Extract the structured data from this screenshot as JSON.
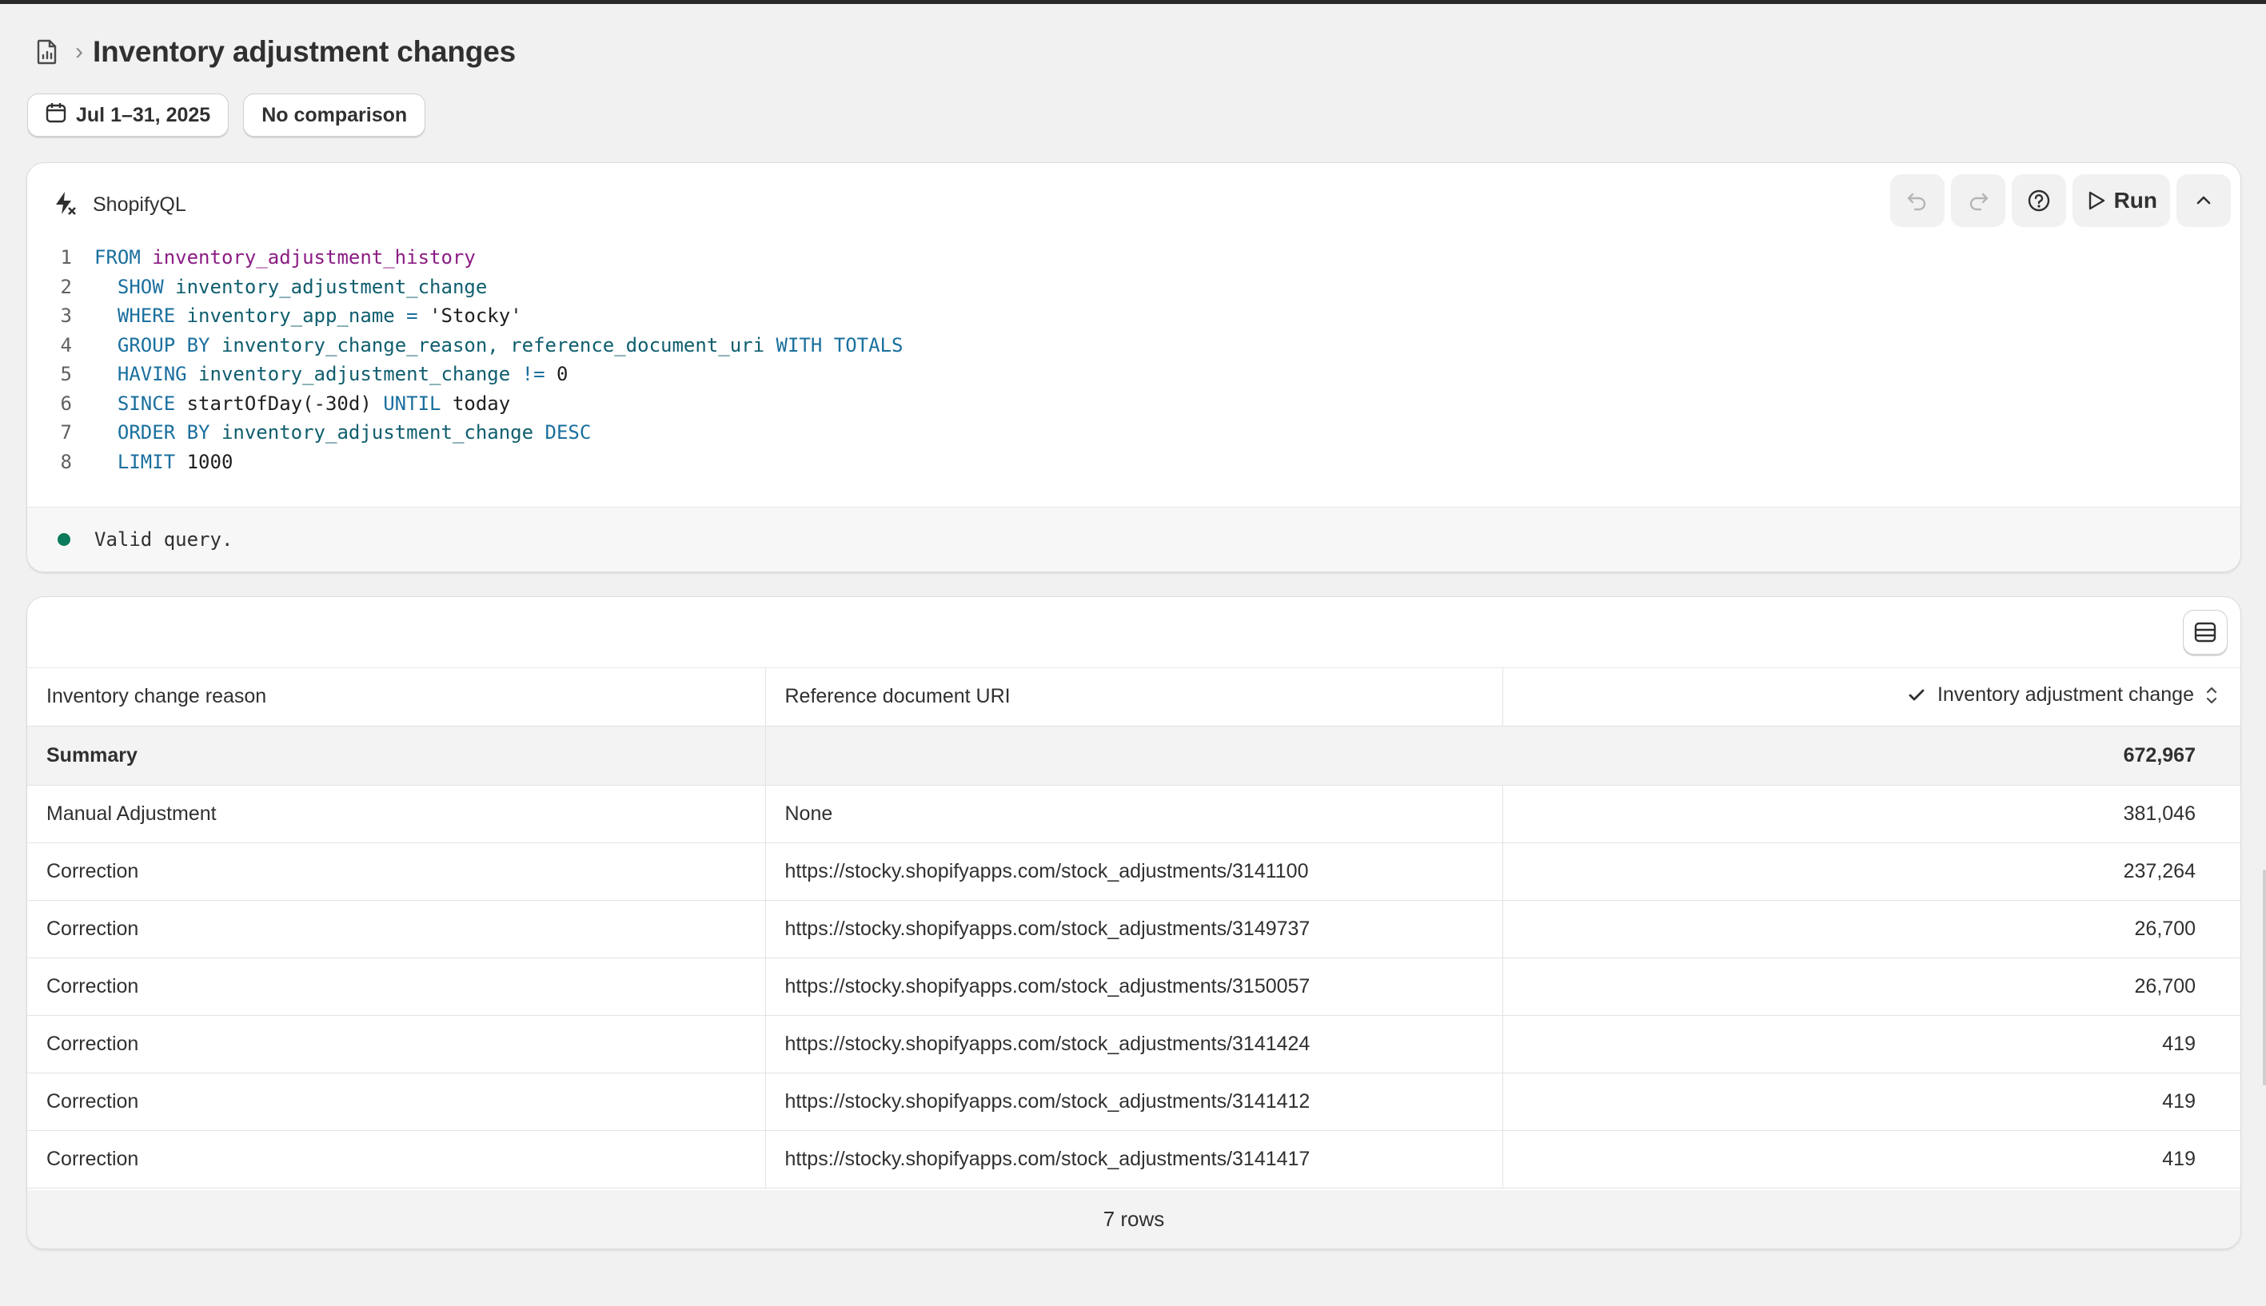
{
  "header": {
    "title": "Inventory adjustment changes",
    "chevron": "›"
  },
  "filters": {
    "date_range": "Jul 1–31, 2025",
    "comparison": "No comparison"
  },
  "editor": {
    "label": "ShopifyQL",
    "run_label": "Run",
    "lines": [
      {
        "n": "1",
        "tokens": [
          {
            "t": "FROM ",
            "c": "kw"
          },
          {
            "t": "inventory_adjustment_history",
            "c": "tbl"
          }
        ]
      },
      {
        "n": "2",
        "tokens": [
          {
            "t": "  SHOW ",
            "c": "kw"
          },
          {
            "t": "inventory_adjustment_change",
            "c": "fld"
          }
        ]
      },
      {
        "n": "3",
        "tokens": [
          {
            "t": "  WHERE ",
            "c": "kw"
          },
          {
            "t": "inventory_app_name ",
            "c": "fld"
          },
          {
            "t": "= ",
            "c": "kw"
          },
          {
            "t": "'Stocky'",
            "c": "plain"
          }
        ]
      },
      {
        "n": "4",
        "tokens": [
          {
            "t": "  GROUP BY ",
            "c": "kw"
          },
          {
            "t": "inventory_change_reason, reference_document_uri ",
            "c": "fld"
          },
          {
            "t": "WITH TOTALS",
            "c": "kw"
          }
        ]
      },
      {
        "n": "5",
        "tokens": [
          {
            "t": "  HAVING ",
            "c": "kw"
          },
          {
            "t": "inventory_adjustment_change ",
            "c": "fld"
          },
          {
            "t": "!= ",
            "c": "kw"
          },
          {
            "t": "0",
            "c": "plain"
          }
        ]
      },
      {
        "n": "6",
        "tokens": [
          {
            "t": "  SINCE ",
            "c": "kw"
          },
          {
            "t": "startOfDay(-30d) ",
            "c": "plain"
          },
          {
            "t": "UNTIL ",
            "c": "kw"
          },
          {
            "t": "today",
            "c": "plain"
          }
        ]
      },
      {
        "n": "7",
        "tokens": [
          {
            "t": "  ORDER BY ",
            "c": "kw"
          },
          {
            "t": "inventory_adjustment_change ",
            "c": "fld"
          },
          {
            "t": "DESC",
            "c": "kw"
          }
        ]
      },
      {
        "n": "8",
        "tokens": [
          {
            "t": "  LIMIT ",
            "c": "kw"
          },
          {
            "t": "1000",
            "c": "plain"
          }
        ]
      }
    ],
    "status": "Valid query."
  },
  "results": {
    "columns": [
      "Inventory change reason",
      "Reference document URI",
      "Inventory adjustment change"
    ],
    "summary": {
      "label": "Summary",
      "value": "672,967"
    },
    "rows": [
      {
        "reason": "Manual Adjustment",
        "uri": "None",
        "value": "381,046"
      },
      {
        "reason": "Correction",
        "uri": "https://stocky.shopifyapps.com/stock_adjustments/3141100",
        "value": "237,264"
      },
      {
        "reason": "Correction",
        "uri": "https://stocky.shopifyapps.com/stock_adjustments/3149737",
        "value": "26,700"
      },
      {
        "reason": "Correction",
        "uri": "https://stocky.shopifyapps.com/stock_adjustments/3150057",
        "value": "26,700"
      },
      {
        "reason": "Correction",
        "uri": "https://stocky.shopifyapps.com/stock_adjustments/3141424",
        "value": "419"
      },
      {
        "reason": "Correction",
        "uri": "https://stocky.shopifyapps.com/stock_adjustments/3141412",
        "value": "419"
      },
      {
        "reason": "Correction",
        "uri": "https://stocky.shopifyapps.com/stock_adjustments/3141417",
        "value": "419"
      }
    ],
    "row_count": "7 rows"
  },
  "icons": [
    "report-icon",
    "calendar-icon",
    "shopifyql-icon",
    "undo-icon",
    "redo-icon",
    "help-icon",
    "play-icon",
    "chevron-up-icon",
    "table-view-icon",
    "check-icon",
    "sort-icon"
  ],
  "colors": {
    "keyword": "#1a6f9e",
    "table": "#8b1c84",
    "field": "#0f5e6e",
    "status_ok": "#0b7a5a"
  }
}
